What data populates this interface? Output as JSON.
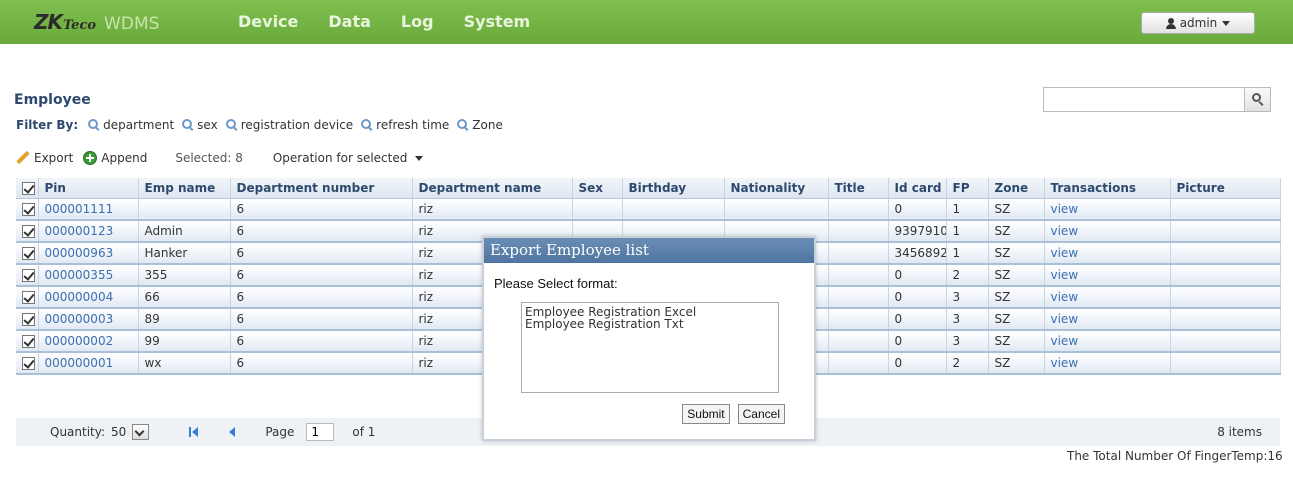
{
  "brand": {
    "logo_main": "ZK",
    "logo_sub": "Teco",
    "app_name": "WDMS"
  },
  "nav": [
    "Device",
    "Data",
    "Log",
    "System"
  ],
  "user": {
    "name": "admin"
  },
  "panel": {
    "title": "Employee",
    "search_value": ""
  },
  "filter": {
    "label": "Filter By:",
    "items": [
      "department",
      "sex",
      "registration device",
      "refresh time",
      "Zone"
    ]
  },
  "toolbar": {
    "export_label": "Export",
    "append_label": "Append",
    "selected_text": "Selected: 8",
    "operation_label": "Operation for selected"
  },
  "table": {
    "columns": [
      "Pin",
      "Emp name",
      "Department number",
      "Department name",
      "Sex",
      "Birthday",
      "Nationality",
      "Title",
      "Id card",
      "FP",
      "Zone",
      "Transactions",
      "Picture"
    ],
    "rows": [
      {
        "pin": "000001111",
        "name": "",
        "dept_no": "6",
        "dept_name": "riz",
        "sex": "",
        "birthday": "",
        "nationality": "",
        "title": "",
        "id_card": "0",
        "fp": "1",
        "zone": "SZ",
        "trans": "view",
        "picture": ""
      },
      {
        "pin": "000000123",
        "name": "Admin",
        "dept_no": "6",
        "dept_name": "riz",
        "sex": "",
        "birthday": "",
        "nationality": "",
        "title": "",
        "id_card": "9397910",
        "fp": "1",
        "zone": "SZ",
        "trans": "view",
        "picture": ""
      },
      {
        "pin": "000000963",
        "name": "Hanker",
        "dept_no": "6",
        "dept_name": "riz",
        "sex": "",
        "birthday": "",
        "nationality": "",
        "title": "",
        "id_card": "3456892",
        "fp": "1",
        "zone": "SZ",
        "trans": "view",
        "picture": ""
      },
      {
        "pin": "000000355",
        "name": "355",
        "dept_no": "6",
        "dept_name": "riz",
        "sex": "",
        "birthday": "",
        "nationality": "",
        "title": "",
        "id_card": "0",
        "fp": "2",
        "zone": "SZ",
        "trans": "view",
        "picture": ""
      },
      {
        "pin": "000000004",
        "name": "66",
        "dept_no": "6",
        "dept_name": "riz",
        "sex": "",
        "birthday": "",
        "nationality": "",
        "title": "",
        "id_card": "0",
        "fp": "3",
        "zone": "SZ",
        "trans": "view",
        "picture": ""
      },
      {
        "pin": "000000003",
        "name": "89",
        "dept_no": "6",
        "dept_name": "riz",
        "sex": "",
        "birthday": "",
        "nationality": "",
        "title": "",
        "id_card": "0",
        "fp": "3",
        "zone": "SZ",
        "trans": "view",
        "picture": ""
      },
      {
        "pin": "000000002",
        "name": "99",
        "dept_no": "6",
        "dept_name": "riz",
        "sex": "",
        "birthday": "",
        "nationality": "",
        "title": "",
        "id_card": "0",
        "fp": "3",
        "zone": "SZ",
        "trans": "view",
        "picture": ""
      },
      {
        "pin": "000000001",
        "name": "wx",
        "dept_no": "6",
        "dept_name": "riz",
        "sex": "",
        "birthday": "",
        "nationality": "",
        "title": "",
        "id_card": "0",
        "fp": "2",
        "zone": "SZ",
        "trans": "view",
        "picture": ""
      }
    ]
  },
  "footer": {
    "quantity_label": "Quantity:",
    "quantity_value": "50",
    "page_label": "Page",
    "page_value": "1",
    "of_label": "of 1",
    "items_label": "8 items",
    "total_text": "The Total Number Of FingerTemp:16"
  },
  "modal": {
    "title": "Export Employee list",
    "prompt": "Please Select format:",
    "options": [
      "Employee Registration Excel",
      "Employee Registration Txt"
    ],
    "submit_label": "Submit",
    "cancel_label": "Cancel"
  }
}
